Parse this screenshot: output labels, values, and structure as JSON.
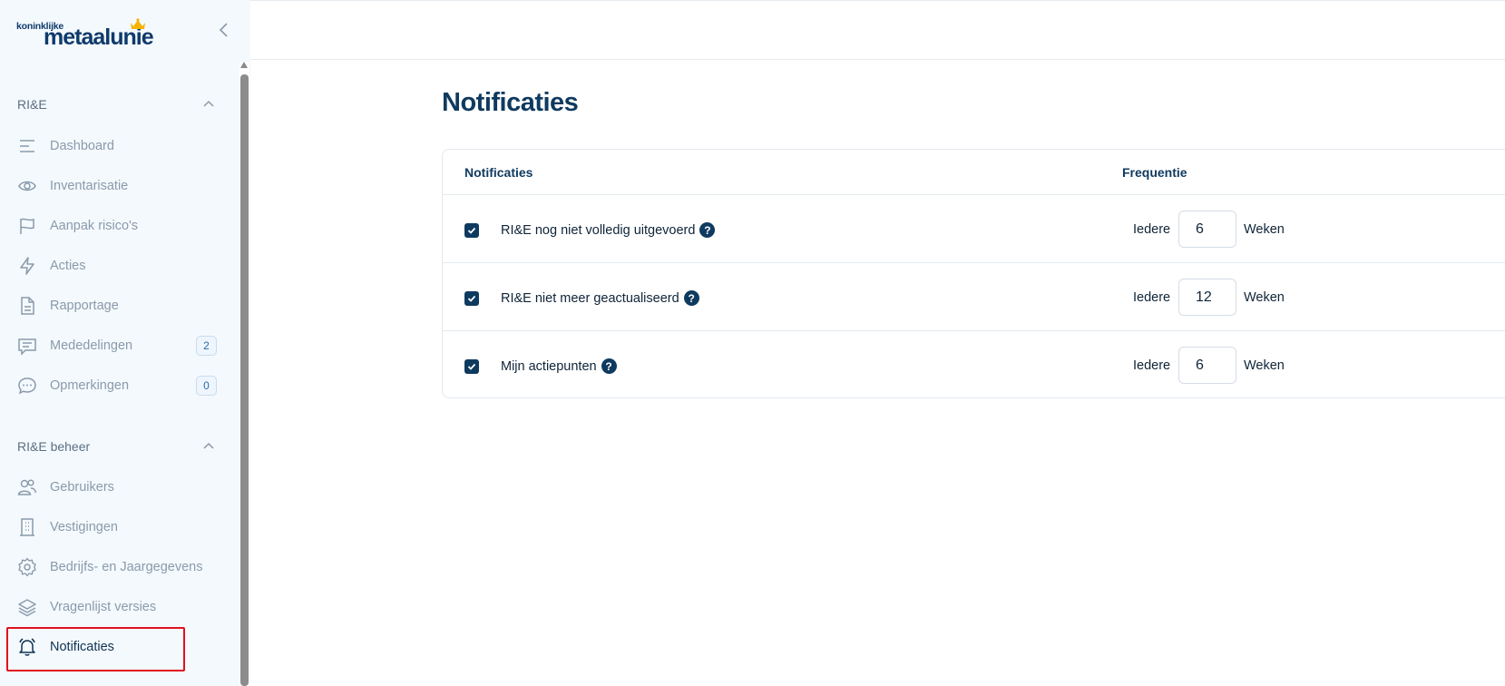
{
  "logo": {
    "small_text": "koninklijke",
    "big_text": "metaalunie"
  },
  "sidebar": {
    "sections": [
      {
        "title": "RI&E",
        "items": [
          {
            "label": "Dashboard",
            "icon": "dashboard-lines-icon"
          },
          {
            "label": "Inventarisatie",
            "icon": "eye-icon"
          },
          {
            "label": "Aanpak risico's",
            "icon": "flag-icon"
          },
          {
            "label": "Acties",
            "icon": "lightning-icon"
          },
          {
            "label": "Rapportage",
            "icon": "document-icon"
          },
          {
            "label": "Mededelingen",
            "icon": "chat-lines-icon",
            "badge": "2"
          },
          {
            "label": "Opmerkingen",
            "icon": "chat-dots-icon",
            "badge": "0"
          }
        ]
      },
      {
        "title": "RI&E beheer",
        "items": [
          {
            "label": "Gebruikers",
            "icon": "users-icon"
          },
          {
            "label": "Vestigingen",
            "icon": "building-icon"
          },
          {
            "label": "Bedrijfs- en Jaargegevens",
            "icon": "gear-icon"
          },
          {
            "label": "Vragenlijst versies",
            "icon": "layers-icon"
          },
          {
            "label": "Notificaties",
            "icon": "bell-icon",
            "active": true
          }
        ]
      }
    ]
  },
  "main": {
    "title": "Notificaties",
    "table": {
      "col_notifications": "Notificaties",
      "col_frequency": "Frequentie",
      "rows": [
        {
          "label": "RI&E nog niet volledig uitgevoerd",
          "checked": true,
          "prefix": "Iedere",
          "value": "6",
          "unit": "Weken"
        },
        {
          "label": "RI&E niet meer geactualiseerd",
          "checked": true,
          "prefix": "Iedere",
          "value": "12",
          "unit": "Weken"
        },
        {
          "label": "Mijn actiepunten",
          "checked": true,
          "prefix": "Iedere",
          "value": "6",
          "unit": "Weken"
        }
      ],
      "help_glyph": "?"
    }
  },
  "colors": {
    "primary": "#0f3a5f",
    "highlight": "#e10f1f",
    "sidebar_bg": "#f4f9fd"
  }
}
